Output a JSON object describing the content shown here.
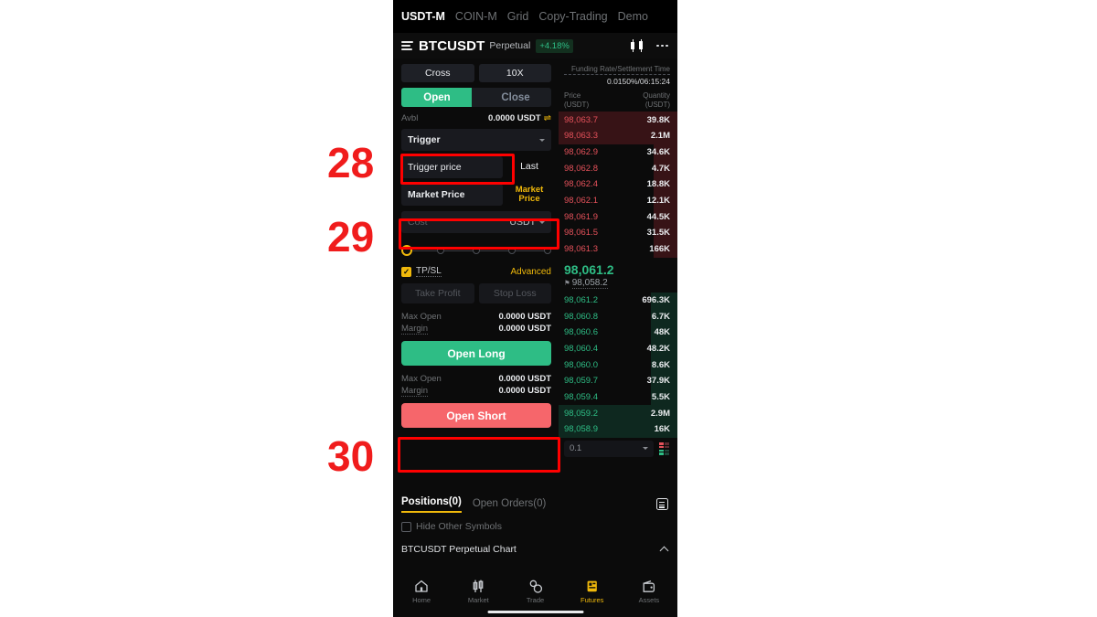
{
  "product_tabs": [
    {
      "label": "USDT-M",
      "active": true
    },
    {
      "label": "COIN-M",
      "active": false
    },
    {
      "label": "Grid",
      "active": false
    },
    {
      "label": "Copy-Trading",
      "active": false
    },
    {
      "label": "Demo",
      "active": false
    }
  ],
  "symbol_header": {
    "menu_icon": "hamburger-icon",
    "symbol": "BTCUSDT",
    "contract_type": "Perpetual",
    "change_pct": "+4.18%",
    "chart_icon": "candlestick-icon",
    "more_icon": "more-dots-icon"
  },
  "order_form": {
    "margin_mode": "Cross",
    "leverage": "10X",
    "open_tab": "Open",
    "close_tab": "Close",
    "avbl_label": "Avbl",
    "avbl_value": "0.0000 USDT",
    "swap_icon": "transfer-icon",
    "order_type": "Trigger",
    "trigger_price_placeholder": "Trigger price",
    "trigger_price_value": "",
    "price_ref": "Last",
    "market_price_label": "Market Price",
    "market_price_side": "Market Price",
    "cost_placeholder": "Cost",
    "cost_value": "",
    "cost_unit": "USDT",
    "tpsl_label": "TP/SL",
    "tpsl_checked": true,
    "advanced_label": "Advanced",
    "take_profit_placeholder": "Take Profit",
    "stop_loss_placeholder": "Stop Loss",
    "long_stats": [
      {
        "label": "Max Open",
        "value": "0.0000 USDT"
      },
      {
        "label": "Margin",
        "value": "0.0000 USDT"
      }
    ],
    "open_long_label": "Open Long",
    "short_stats": [
      {
        "label": "Max Open",
        "value": "0.0000 USDT"
      },
      {
        "label": "Margin",
        "value": "0.0000 USDT"
      }
    ],
    "open_short_label": "Open Short"
  },
  "orderbook": {
    "funding_label": "Funding Rate/Settlement Time",
    "funding_value": "0.0150%/06:15:24",
    "col_price": "Price",
    "col_price_unit": "(USDT)",
    "col_qty": "Quantity",
    "col_qty_unit": "(USDT)",
    "asks": [
      {
        "price": "98,063.7",
        "qty": "39.8K",
        "depth": 100
      },
      {
        "price": "98,063.3",
        "qty": "2.1M",
        "depth": 100
      },
      {
        "price": "98,062.9",
        "qty": "34.6K",
        "depth": 20
      },
      {
        "price": "98,062.8",
        "qty": "4.7K",
        "depth": 20
      },
      {
        "price": "98,062.4",
        "qty": "18.8K",
        "depth": 20
      },
      {
        "price": "98,062.1",
        "qty": "12.1K",
        "depth": 20
      },
      {
        "price": "98,061.9",
        "qty": "44.5K",
        "depth": 20
      },
      {
        "price": "98,061.5",
        "qty": "31.5K",
        "depth": 20
      },
      {
        "price": "98,061.3",
        "qty": "166K",
        "depth": 20
      }
    ],
    "mid_price": "98,061.2",
    "mark_price": "98,058.2",
    "mark_icon": "flag-icon",
    "bids": [
      {
        "price": "98,061.2",
        "qty": "696.3K",
        "depth": 22
      },
      {
        "price": "98,060.8",
        "qty": "6.7K",
        "depth": 22
      },
      {
        "price": "98,060.6",
        "qty": "48K",
        "depth": 22
      },
      {
        "price": "98,060.4",
        "qty": "48.2K",
        "depth": 22
      },
      {
        "price": "98,060.0",
        "qty": "8.6K",
        "depth": 22
      },
      {
        "price": "98,059.7",
        "qty": "37.9K",
        "depth": 22
      },
      {
        "price": "98,059.4",
        "qty": "5.5K",
        "depth": 22
      },
      {
        "price": "98,059.2",
        "qty": "2.9M",
        "depth": 100
      },
      {
        "price": "98,058.9",
        "qty": "16K",
        "depth": 100
      }
    ],
    "grouping": "0.1",
    "depth_view_icon": "orderbook-view-icon"
  },
  "positions": {
    "tabs": [
      {
        "label": "Positions(0)",
        "active": true
      },
      {
        "label": "Open Orders(0)",
        "active": false
      }
    ],
    "list_icon": "list-view-icon",
    "hide_other_symbols": "Hide Other Symbols",
    "hide_other_checked": false,
    "chart_bar_label": "BTCUSDT Perpetual Chart",
    "chart_bar_icon": "chevron-up-icon"
  },
  "bottom_nav": [
    {
      "label": "Home",
      "icon": "home-icon",
      "active": false
    },
    {
      "label": "Market",
      "icon": "market-icon",
      "active": false
    },
    {
      "label": "Trade",
      "icon": "trade-icon",
      "active": false
    },
    {
      "label": "Futures",
      "icon": "futures-icon",
      "active": true
    },
    {
      "label": "Assets",
      "icon": "assets-icon",
      "active": false
    }
  ],
  "annotations": [
    {
      "number": "28",
      "target": "trigger-price-field"
    },
    {
      "number": "29",
      "target": "cost-field"
    },
    {
      "number": "30",
      "target": "open-short-button"
    }
  ],
  "colors": {
    "accent_gold": "#f0b90b",
    "long_green": "#2ebd85",
    "short_red": "#f6666b",
    "ask_red": "#e4515a",
    "annotation_red": "#ff0000"
  }
}
